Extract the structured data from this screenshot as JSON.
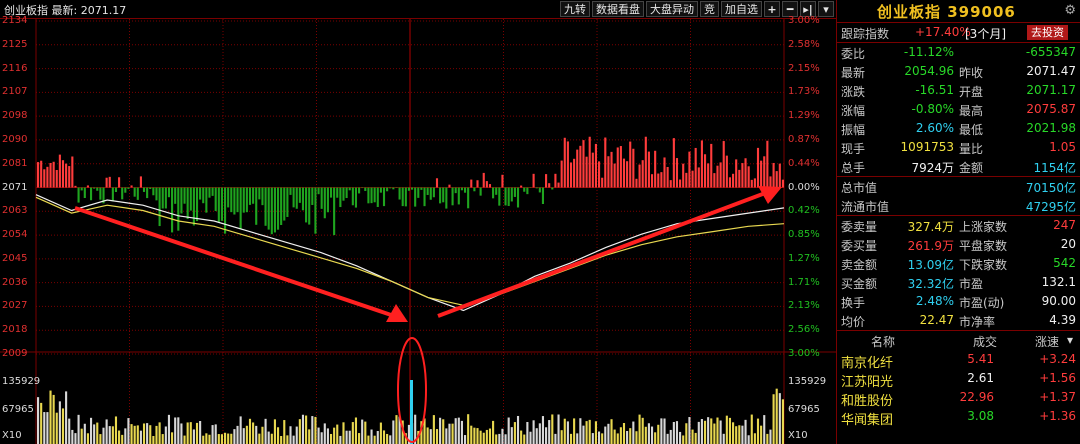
{
  "header": {
    "title": "创业板指  最新: 2071.17",
    "buttons": [
      "九转",
      "数据看盘",
      "大盘异动",
      "竞",
      "加自选"
    ],
    "icon_plus": "+",
    "icon_minus": "━",
    "icon_arrow": "▸|",
    "icon_menu": "▾"
  },
  "axes": {
    "price_left": [
      "2134",
      "2125",
      "2116",
      "2107",
      "2098",
      "2090",
      "2081",
      "2071",
      "2063",
      "2054",
      "2045",
      "2036",
      "2027",
      "2018",
      "2009"
    ],
    "pct_right": [
      "3.00%",
      "2.58%",
      "2.15%",
      "1.73%",
      "1.29%",
      "0.87%",
      "0.44%",
      "0.00%",
      "0.42%",
      "0.85%",
      "1.27%",
      "1.71%",
      "2.13%",
      "2.56%",
      "3.00%"
    ],
    "volume_left": [
      "135929",
      "67965",
      "X10"
    ],
    "volume_right": [
      "135929",
      "67965",
      "X10"
    ]
  },
  "chart_data": {
    "type": "line",
    "title": "创业板指",
    "series": [
      {
        "values": [
          2068,
          2062,
          2066,
          2064,
          2060,
          2058,
          2054,
          2050,
          2046,
          2041,
          2035,
          2029,
          2024,
          2030,
          2037,
          2042,
          2048,
          2053,
          2057,
          2059,
          2061,
          2063
        ]
      },
      {
        "values": [
          2067,
          2061,
          2064,
          2062,
          2058,
          2056,
          2052,
          2048,
          2044,
          2040,
          2035,
          2029,
          2026,
          2030,
          2035,
          2040,
          2045,
          2049,
          2052,
          2054,
          2056,
          2057
        ]
      }
    ],
    "ylim": [
      2009,
      2134
    ]
  },
  "quote": {
    "name": "创业板指",
    "code": "399006",
    "track_label": "跟踪指数",
    "track_value": "+17.40%",
    "track_period": "[3个月]",
    "invest_button": "去投资",
    "rows": [
      {
        "l1": "委比",
        "v1": "-11.12%",
        "c1": "green",
        "l2": "",
        "v2": "-655347",
        "c2": "green"
      },
      {
        "l1": "最新",
        "v1": "2054.96",
        "c1": "green",
        "l2": "昨收",
        "v2": "2071.47",
        "c2": "white"
      },
      {
        "l1": "涨跌",
        "v1": "-16.51",
        "c1": "green",
        "l2": "开盘",
        "v2": "2071.17",
        "c2": "green"
      },
      {
        "l1": "涨幅",
        "v1": "-0.80%",
        "c1": "green",
        "l2": "最高",
        "v2": "2075.87",
        "c2": "red"
      },
      {
        "l1": "振幅",
        "v1": "2.60%",
        "c1": "cyan",
        "l2": "最低",
        "v2": "2021.98",
        "c2": "green"
      },
      {
        "l1": "现手",
        "v1": "1091753",
        "c1": "yellow",
        "l2": "量比",
        "v2": "1.05",
        "c2": "red"
      },
      {
        "l1": "总手",
        "v1": "7924万",
        "c1": "white",
        "l2": "金额",
        "v2": "1154亿",
        "c2": "cyan"
      }
    ],
    "market": [
      {
        "l": "总市值",
        "v": "70150亿"
      },
      {
        "l": "流通市值",
        "v": "47295亿"
      }
    ],
    "rows2": [
      {
        "l1": "委卖量",
        "v1": "327.4万",
        "c1": "yellow",
        "l2": "上涨家数",
        "v2": "247",
        "c2": "red"
      },
      {
        "l1": "委买量",
        "v1": "261.9万",
        "c1": "red",
        "l2": "平盘家数",
        "v2": "20",
        "c2": "white"
      },
      {
        "l1": "卖金额",
        "v1": "13.09亿",
        "c1": "cyan",
        "l2": "下跌家数",
        "v2": "542",
        "c2": "green"
      },
      {
        "l1": "买金额",
        "v1": "32.32亿",
        "c1": "cyan",
        "l2": "市盈",
        "v2": "132.1",
        "c2": "white"
      },
      {
        "l1": "换手",
        "v1": "2.48%",
        "c1": "cyan",
        "l2": "市盈(动)",
        "v2": "90.00",
        "c2": "white"
      },
      {
        "l1": "均价",
        "v1": "22.47",
        "c1": "yellow",
        "l2": "市净率",
        "v2": "4.39",
        "c2": "white"
      }
    ],
    "list_header": {
      "name": "名称",
      "trade": "成交",
      "speed": "涨速"
    },
    "stocks": [
      {
        "name": "南京化纤",
        "trade": "5.41",
        "tc": "red",
        "speed": "+3.24"
      },
      {
        "name": "江苏阳光",
        "trade": "2.61",
        "tc": "white",
        "speed": "+1.56"
      },
      {
        "name": "和胜股份",
        "trade": "22.96",
        "tc": "red",
        "speed": "+1.37"
      },
      {
        "name": "华闻集团",
        "trade": "3.08",
        "tc": "green",
        "speed": "+1.36"
      }
    ]
  },
  "colors": {
    "up": "#ff3c3c",
    "down": "#28d828",
    "grid": "#7a0000",
    "price_line": "#f0f0f0",
    "avg_line": "#e8d850",
    "annotation": "#ff2020"
  }
}
